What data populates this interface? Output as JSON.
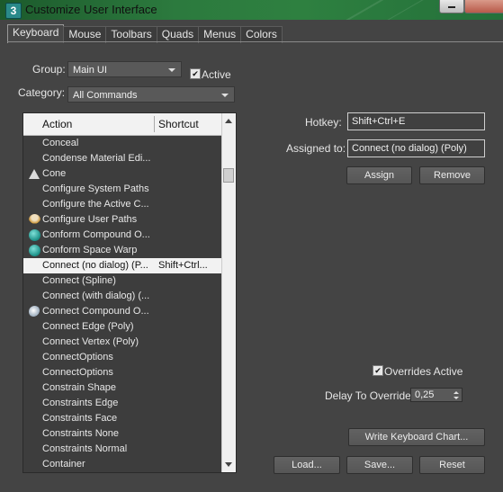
{
  "window": {
    "title": "Customize User Interface",
    "icon_text": "3"
  },
  "tabs": [
    {
      "label": "Keyboard",
      "active": true
    },
    {
      "label": "Mouse"
    },
    {
      "label": "Toolbars"
    },
    {
      "label": "Quads"
    },
    {
      "label": "Menus"
    },
    {
      "label": "Colors"
    }
  ],
  "group": {
    "label": "Group:",
    "value": "Main UI",
    "active_label": "Active",
    "active_checked": true
  },
  "category": {
    "label": "Category:",
    "value": "All Commands"
  },
  "list": {
    "columns": {
      "action": "Action",
      "shortcut": "Shortcut"
    },
    "rows": [
      {
        "action": "Conceal",
        "shortcut": "",
        "icon": ""
      },
      {
        "action": "Condense Material Edi...",
        "shortcut": "",
        "icon": ""
      },
      {
        "action": "Cone",
        "shortcut": "",
        "icon": "cone-icon"
      },
      {
        "action": "Configure System Paths",
        "shortcut": "",
        "icon": ""
      },
      {
        "action": "Configure the Active C...",
        "shortcut": "",
        "icon": ""
      },
      {
        "action": "Configure User Paths",
        "shortcut": "",
        "icon": "user-paths-icon"
      },
      {
        "action": "Conform Compound O...",
        "shortcut": "",
        "icon": "conform-compound-icon"
      },
      {
        "action": "Conform Space Warp",
        "shortcut": "",
        "icon": "conform-spacewarp-icon"
      },
      {
        "action": "Connect (no dialog) (P...",
        "shortcut": "Shift+Ctrl...",
        "icon": "",
        "selected": true
      },
      {
        "action": "Connect (Spline)",
        "shortcut": "",
        "icon": ""
      },
      {
        "action": "Connect (with dialog) (...",
        "shortcut": "",
        "icon": ""
      },
      {
        "action": "Connect Compound O...",
        "shortcut": "",
        "icon": "connect-compound-icon"
      },
      {
        "action": "Connect Edge (Poly)",
        "shortcut": "",
        "icon": ""
      },
      {
        "action": "Connect Vertex (Poly)",
        "shortcut": "",
        "icon": ""
      },
      {
        "action": "ConnectOptions",
        "shortcut": "",
        "icon": ""
      },
      {
        "action": "ConnectOptions",
        "shortcut": "",
        "icon": ""
      },
      {
        "action": "Constrain Shape",
        "shortcut": "",
        "icon": ""
      },
      {
        "action": "Constraints Edge",
        "shortcut": "",
        "icon": ""
      },
      {
        "action": "Constraints Face",
        "shortcut": "",
        "icon": ""
      },
      {
        "action": "Constraints None",
        "shortcut": "",
        "icon": ""
      },
      {
        "action": "Constraints Normal",
        "shortcut": "",
        "icon": ""
      },
      {
        "action": "Container",
        "shortcut": "",
        "icon": ""
      }
    ]
  },
  "hotkey": {
    "label": "Hotkey:",
    "value": "Shift+Ctrl+E"
  },
  "assigned_to": {
    "label": "Assigned to:",
    "value": "Connect (no dialog) (Poly)"
  },
  "buttons": {
    "assign": "Assign",
    "remove": "Remove",
    "write_chart": "Write Keyboard Chart...",
    "load": "Load...",
    "save": "Save...",
    "reset": "Reset"
  },
  "overrides": {
    "label": "Overrides Active",
    "checked": true
  },
  "delay": {
    "label": "Delay To Override:",
    "value": "0,25"
  }
}
